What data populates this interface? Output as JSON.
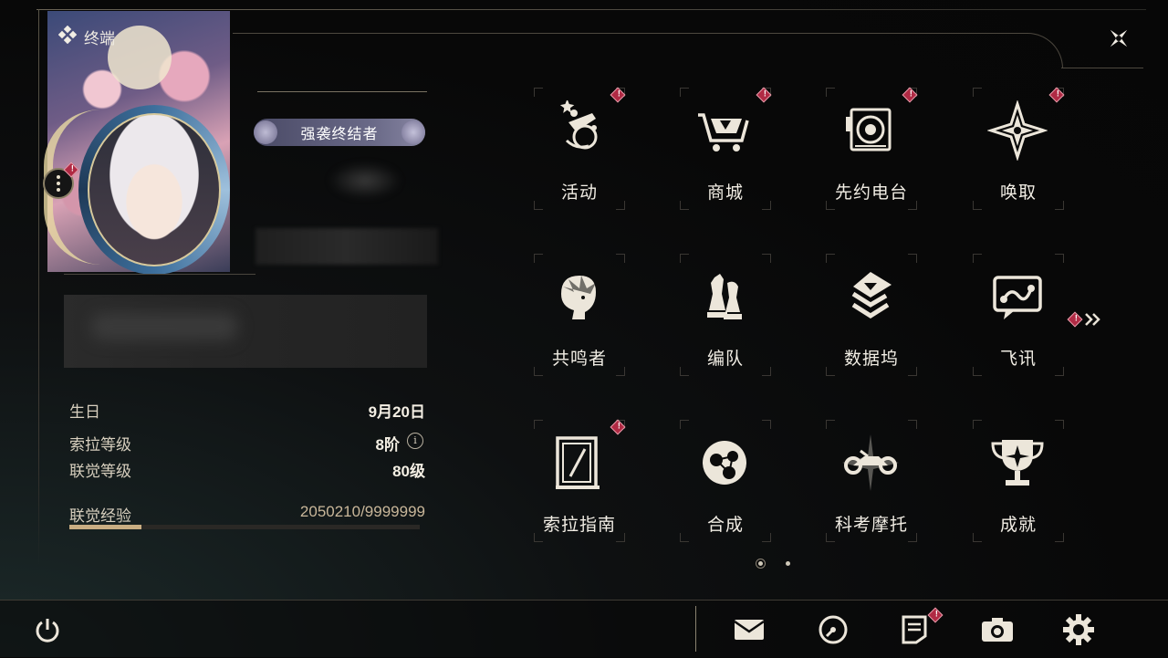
{
  "header": {
    "title": "终端"
  },
  "profile": {
    "title_tag": "强袭终结者"
  },
  "info": {
    "birthday_label": "生日",
    "birthday_value": "9月20日",
    "sola_level_label": "索拉等级",
    "sola_level_value": "8阶",
    "info_symbol": "i",
    "union_level_label": "联觉等级",
    "union_level_value": "80级",
    "union_exp_label": "联觉经验",
    "union_exp_value": "2050210/9999999",
    "union_exp_progress": 0.205
  },
  "menu": {
    "items": [
      {
        "label": "活动",
        "icon": "activity-icon",
        "badge": true
      },
      {
        "label": "商城",
        "icon": "shop-cart-icon",
        "badge": true
      },
      {
        "label": "先约电台",
        "icon": "radio-icon",
        "badge": true
      },
      {
        "label": "唤取",
        "icon": "summon-star-icon",
        "badge": true
      },
      {
        "label": "共鸣者",
        "icon": "resonator-portrait-icon",
        "badge": false
      },
      {
        "label": "编队",
        "icon": "team-chess-icon",
        "badge": false
      },
      {
        "label": "数据坞",
        "icon": "data-dock-icon",
        "badge": false
      },
      {
        "label": "飞讯",
        "icon": "message-icon",
        "badge": false
      },
      {
        "label": "索拉指南",
        "icon": "guidebook-icon",
        "badge": true
      },
      {
        "label": "合成",
        "icon": "synthesis-icon",
        "badge": false
      },
      {
        "label": "科考摩托",
        "icon": "motorcycle-icon",
        "badge": false
      },
      {
        "label": "成就",
        "icon": "trophy-icon",
        "badge": false
      }
    ],
    "page_indicator": {
      "current": 1,
      "total": 2
    }
  },
  "footer": {
    "power": "power-icon",
    "mail": "mail-icon",
    "clock": "clock-icon",
    "notice": "notice-icon",
    "camera": "camera-icon",
    "settings": "settings-gear-icon"
  },
  "colors": {
    "badge": "#b02a44",
    "accent": "#c9ad82",
    "text": "#f1ede4"
  }
}
